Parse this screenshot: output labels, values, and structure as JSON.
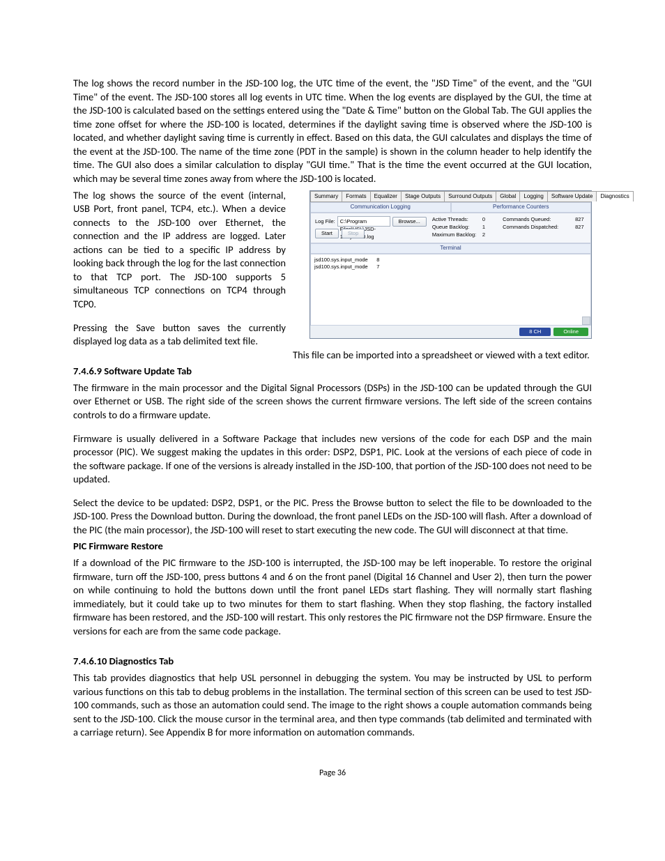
{
  "para1": "The log shows the record number in the JSD-100 log, the UTC time of the event, the \"JSD Time\" of the event, and the \"GUI Time\" of the event. The JSD-100 stores all log events in UTC time.  When the log events are displayed by the GUI, the time at the JSD-100 is calculated based on the settings entered using the \"Date & Time\" button on the Global Tab. The GUI applies the time zone offset for where the JSD-100 is located, determines if the daylight saving time is observed where the JSD-100 is located, and whether daylight saving time is currently in effect. Based on this data, the GUI calculates and displays the time of the event at the JSD-100. The name of the time zone (PDT in the sample) is shown in the column header to help identify the time. The GUI also does a similar calculation to display \"GUI time.\" That is the time the event occurred at the GUI location, which may be several time zones away from where the JSD-100 is located.",
  "para2": "The log shows the source of the event (internal, USB Port, front panel, TCP4, etc.).  When a device connects to the JSD-100 over Ethernet, the connection and the IP address are logged. Later actions can be tied to a specific IP address by looking back through the log for the last connection to that TCP port. The JSD-100 supports 5 simultaneous TCP connections on TCP4 through TCP0.",
  "para3a": "Pressing the Save button saves the currently displayed log data as a tab delimited text file.",
  "para3b": "This file can be imported into a spreadsheet or viewed with a text editor.",
  "h1": "7.4.6.9   Software Update Tab",
  "p4": "The firmware in the main processor and the Digital Signal Processors (DSPs) in the JSD-100 can be updated through the GUI over Ethernet or USB. The right side of the screen shows the current firmware versions. The left side of the screen contains controls to do a firmware update.",
  "p5": "Firmware is usually delivered in a Software Package that includes new versions of the code for each DSP and the main processor (PIC).  We suggest making the updates in this order: DSP2, DSP1, PIC.  Look at the versions of each piece of code in the software package. If one of the versions is already installed in the JSD-100, that portion of the JSD-100 does not need to be updated.",
  "p6": "Select the device to be updated: DSP2, DSP1, or the PIC. Press the Browse button to select the file to be downloaded to the JSD-100.  Press the Download button. During the download, the front panel LEDs on the JSD-100 will flash. After a download of the PIC (the main processor), the JSD-100 will reset to start executing the new code. The GUI will disconnect at that time.",
  "h2": "PIC Firmware Restore",
  "p7": "If a download of the PIC firmware to the JSD-100 is interrupted, the JSD-100 may be left inoperable. To restore the original firmware, turn off the JSD-100, press buttons 4 and 6 on the front panel (Digital 16 Channel and User 2), then turn the power on while continuing to hold the buttons down until the front panel LEDs start flashing.  They will normally start flashing immediately, but it could take up to two minutes for them to start flashing.  When they stop flashing, the factory installed firmware has been restored, and the JSD-100 will restart.  This only restores the PIC firmware not the DSP firmware.  Ensure the versions for each are from the same code package.",
  "h3": "7.4.6.10 Diagnostics Tab",
  "p8": "This tab provides diagnostics that help USL personnel in debugging the system.  You may be instructed by USL to perform various functions on this tab to debug problems in the installation. The terminal section of this screen can be used to test JSD-100 commands, such as those an automation could send.  The image to the right shows a couple automation commands being sent to the JSD-100. Click the mouse cursor in the terminal area, and then type commands (tab delimited and terminated with a carriage return).  See Appendix B for more information on automation commands.",
  "pagenum": "Page 36",
  "fig": {
    "tabs": [
      "Summary",
      "Formats",
      "Equalizer",
      "Stage Outputs",
      "Surround Outputs",
      "Global",
      "Logging",
      "Software Update",
      "Diagnostics"
    ],
    "sec_left": "Communication Logging",
    "sec_right": "Performance Counters",
    "logfile_label": "Log File:",
    "logfile_value": "C:\\Program Files\\USL\\JSD-100\\jsd100.log",
    "browse": "Browse...",
    "start": "Start",
    "stop": "Stop",
    "active_threads_l": "Active Threads:",
    "active_threads_v": "0",
    "queue_backlog_l": "Queue Backlog:",
    "queue_backlog_v": "1",
    "max_backlog_l": "Maximum Backlog:",
    "max_backlog_v": "2",
    "cmds_queued_l": "Commands Queued:",
    "cmds_queued_v": "827",
    "cmds_disp_l": "Commands Dispatched:",
    "cmds_disp_v": "827",
    "terminal": "Terminal",
    "tline1": "jsd100.sys.input_mode      8",
    "tline2": "jsd100.sys.input_mode      7",
    "status1": "8 CH",
    "status2": "Online"
  }
}
